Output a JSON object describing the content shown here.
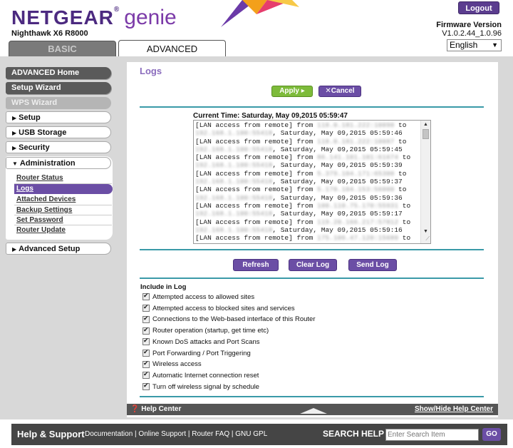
{
  "header": {
    "brand_main": "NETGEAR",
    "brand_reg": "®",
    "brand_genie": "genie",
    "model": "Nighthawk X6 R8000",
    "logout_label": "Logout",
    "firmware_label": "Firmware Version",
    "firmware_version": "V1.0.2.44_1.0.96",
    "language": "English"
  },
  "tabs": {
    "basic": "BASIC",
    "advanced": "ADVANCED"
  },
  "sidebar": {
    "advanced_home": "ADVANCED Home",
    "setup_wizard": "Setup Wizard",
    "wps_wizard": "WPS Wizard",
    "setup": "Setup",
    "usb_storage": "USB Storage",
    "security": "Security",
    "administration": "Administration",
    "admin_items": [
      "Router Status",
      "Logs",
      "Attached Devices",
      "Backup Settings",
      "Set Password",
      "Router Update"
    ],
    "advanced_setup": "Advanced Setup"
  },
  "main": {
    "title": "Logs",
    "apply_label": "Apply ▸",
    "cancel_label": "✕Cancel",
    "current_time": "Current Time: Saturday, May 09,2015 05:59:47",
    "log_lines": [
      {
        "prefix": "[LAN access from remote] from ",
        "ip": "118.0.181.222:10090",
        "suffix": " to"
      },
      {
        "ip": "192.168.1.100:55418",
        "suffix": ", Saturday, May 09,2015 05:59:46"
      },
      {
        "prefix": "[LAN access from remote] from ",
        "ip": "118.0.181.222:10087",
        "suffix": " to"
      },
      {
        "ip": "192.168.1.100:55418",
        "suffix": ", Saturday, May 09,2015 05:59:45"
      },
      {
        "prefix": "[LAN access from remote] from ",
        "ip": "86.141.101.101:61674",
        "suffix": " to"
      },
      {
        "ip": "192.168.1.100:55418",
        "suffix": ", Saturday, May 09,2015 05:59:39"
      },
      {
        "prefix": "[LAN access from remote] from ",
        "ip": "5.379.104.171:65300",
        "suffix": " to"
      },
      {
        "ip": "192.168.1.100:55418",
        "suffix": ", Saturday, May 09,2015 05:59:37"
      },
      {
        "prefix": "[LAN access from remote] from ",
        "ip": "5.170.104.153:56000",
        "suffix": " to"
      },
      {
        "ip": "192.168.1.100:55418",
        "suffix": ", Saturday, May 09,2015 05:59:36"
      },
      {
        "prefix": "[LAN access from remote] from ",
        "ip": "100.110.75.170:55931",
        "suffix": " to"
      },
      {
        "ip": "192.168.1.100:55418",
        "suffix": ", Saturday, May 09,2015 05:59:17"
      },
      {
        "prefix": "[LAN access from remote] from ",
        "ip": "119.20.166.217:57812",
        "suffix": " to"
      },
      {
        "ip": "192.168.1.100:55418",
        "suffix": ", Saturday, May 09,2015 05:59:16"
      },
      {
        "prefix": "[LAN access from remote] from ",
        "ip": "175.106.47.120:15680",
        "suffix": " to"
      }
    ],
    "refresh_label": "Refresh",
    "clear_log_label": "Clear Log",
    "send_log_label": "Send Log",
    "include_heading": "Include in Log",
    "include_options": [
      "Attempted access to allowed sites",
      "Attempted access to blocked sites and services",
      "Connections to the Web-based interface of this Router",
      "Router operation (startup, get time etc)",
      "Known DoS attacks and Port Scans",
      "Port Forwarding / Port Triggering",
      "Wireless access",
      "Automatic Internet connection reset",
      "Turn off wireless signal by schedule"
    ]
  },
  "helpbar": {
    "help_center": "Help Center",
    "show_hide": "Show/Hide Help Center"
  },
  "footer": {
    "help_support": "Help & Support",
    "links": [
      "Documentation",
      "Online Support",
      "Router FAQ",
      "GNU GPL"
    ],
    "search_label": "SEARCH HELP",
    "search_placeholder": "Enter Search Item",
    "go_label": "GO"
  },
  "colors": {
    "purple": "#6b4ea5",
    "green": "#7dbb3a",
    "teal": "#3a9aa8"
  }
}
